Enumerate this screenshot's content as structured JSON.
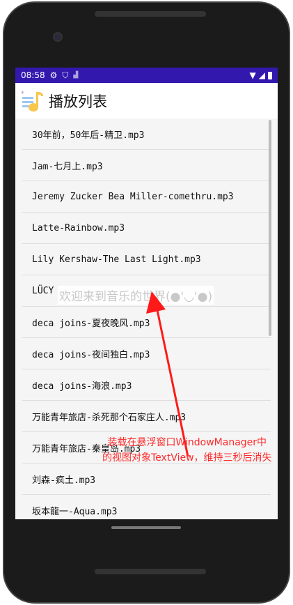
{
  "status": {
    "time": "08:58"
  },
  "appbar": {
    "title": "播放列表"
  },
  "songs": [
    "30年前，50年后-精卫.mp3",
    "Jam-七月上.mp3",
    "Jeremy Zucker Bea Miller-comethru.mp3",
    "Latte-Rainbow.mp3",
    "Lily Kershaw-The Last Light.mp3",
    "LÜCY",
    "deca joins-夏夜晚风.mp3",
    "deca joins-夜间独白.mp3",
    "deca joins-海浪.mp3",
    "万能青年旅店-杀死那个石家庄人.mp3",
    "万能青年旅店-秦皇岛.mp3",
    "刘森-疯土.mp3",
    "坂本龍一-Aqua.mp3"
  ],
  "toast": "欢迎来到音乐的世界(●'◡'●)",
  "annotation": {
    "line1": "装载在悬浮窗口WindowManager中",
    "line2": "的视图对象TextView，维持三秒后消失"
  },
  "colors": {
    "statusbar": "#3318ae",
    "annotation": "#ff2a2a"
  }
}
